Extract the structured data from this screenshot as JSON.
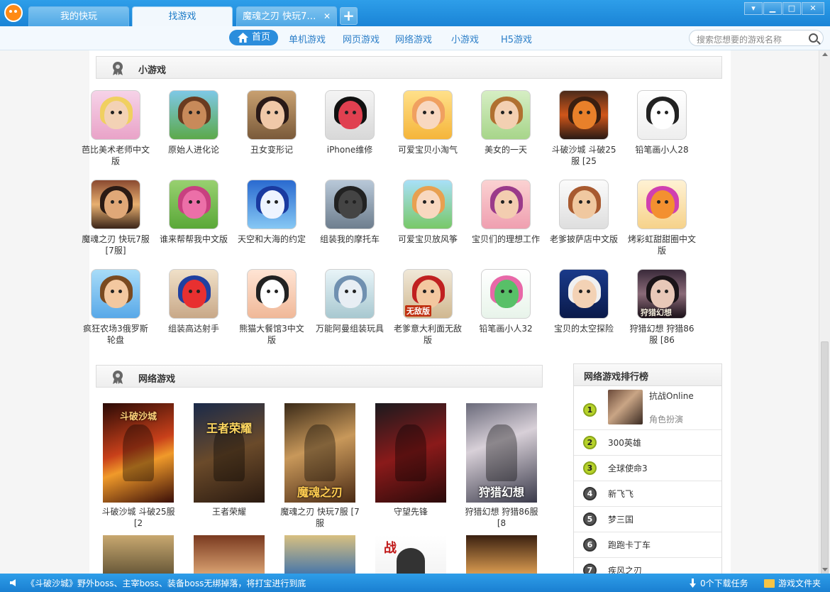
{
  "tabs": [
    {
      "label": "我的快玩"
    },
    {
      "label": "找游戏"
    },
    {
      "label": "魔魂之刃 快玩7…"
    }
  ],
  "nav": {
    "home": "首页",
    "links": [
      "单机游戏",
      "网页游戏",
      "网络游戏",
      "小游戏",
      "H5游戏"
    ],
    "search_placeholder": "搜索您想要的游戏名称"
  },
  "small_games": {
    "title": "小游戏",
    "items": [
      {
        "name": "芭比美术老师中文版"
      },
      {
        "name": "原始人进化论"
      },
      {
        "name": "丑女变形记"
      },
      {
        "name": "iPhone维修"
      },
      {
        "name": "可爱宝贝小淘气"
      },
      {
        "name": "美女的一天"
      },
      {
        "name": "斗破沙城 斗破25服 [25"
      },
      {
        "name": "铅笔画小人28"
      },
      {
        "name": "魔魂之刃 快玩7服 [7服]"
      },
      {
        "name": "谁来帮帮我中文版"
      },
      {
        "name": "天空和大海的约定"
      },
      {
        "name": "组装我的摩托车"
      },
      {
        "name": "可爱宝贝放风筝"
      },
      {
        "name": "宝贝们的理想工作"
      },
      {
        "name": "老爹披萨店中文版"
      },
      {
        "name": "烤彩虹甜甜圈中文版"
      },
      {
        "name": "疯狂农场3俄罗斯轮盘"
      },
      {
        "name": "组装高达射手"
      },
      {
        "name": "熊猫大餐馆3中文版"
      },
      {
        "name": "万能阿曼组装玩具"
      },
      {
        "name": "老爹意大利面无敌版"
      },
      {
        "name": "铅笔画小人32"
      },
      {
        "name": "宝贝的太空探险"
      },
      {
        "name": "狩猎幻想 狩猎86服 [86"
      }
    ]
  },
  "net_games": {
    "title": "网络游戏",
    "items": [
      {
        "name": "斗破沙城 斗破25服 [2",
        "art": "斗破沙城"
      },
      {
        "name": "王者荣耀",
        "art": "王者荣耀"
      },
      {
        "name": "魔魂之刃 快玩7服 [7服",
        "art": "魔魂之刃"
      },
      {
        "name": "守望先锋",
        "art": ""
      },
      {
        "name": "狩猎幻想 狩猎86服 [8",
        "art": "狩猎幻想"
      }
    ],
    "bottom_art": "战"
  },
  "ranking": {
    "title": "网络游戏排行榜",
    "first": {
      "num": "1",
      "name": "抗战Online",
      "sub": "角色扮演"
    },
    "items": [
      {
        "num": "2",
        "name": "300英雄"
      },
      {
        "num": "3",
        "name": "全球使命3"
      },
      {
        "num": "4",
        "name": "新飞飞"
      },
      {
        "num": "5",
        "name": "梦三国"
      },
      {
        "num": "6",
        "name": "跑跑卡丁车"
      },
      {
        "num": "7",
        "name": "疾风之刃"
      }
    ]
  },
  "icon_labels": {
    "small_20": "无敌版",
    "small_31": "狩猎幻想"
  },
  "status": {
    "message": "《斗破沙城》野外boss、主宰boss、装备boss无绑掉落，将打宝进行到底",
    "downloads": "0个下载任务",
    "folder": "游戏文件夹"
  },
  "colors": {
    "accent": "#1a84d6",
    "rank_top": "#b7d32a",
    "rank_rest": "#555555"
  }
}
